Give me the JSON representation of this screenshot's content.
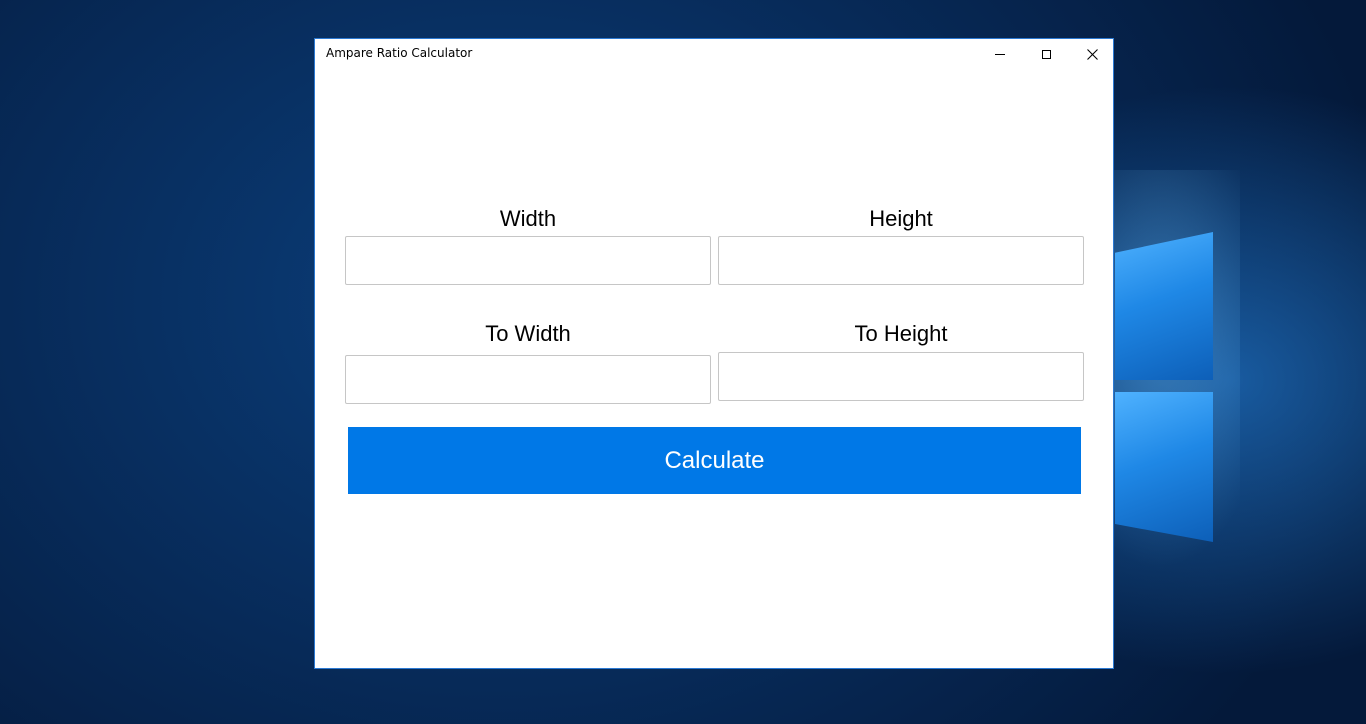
{
  "window": {
    "title": "Ampare Ratio Calculator"
  },
  "form": {
    "width_label": "Width",
    "height_label": "Height",
    "to_width_label": "To Width",
    "to_height_label": "To Height",
    "width_value": "",
    "height_value": "",
    "to_width_value": "",
    "to_height_value": "",
    "calculate_label": "Calculate"
  },
  "icons": {
    "minimize": "minimize-icon",
    "maximize": "maximize-icon",
    "close": "close-icon"
  },
  "colors": {
    "accent": "#0078e7",
    "window_border": "#2b79d3",
    "input_border": "#c6c6c6"
  }
}
